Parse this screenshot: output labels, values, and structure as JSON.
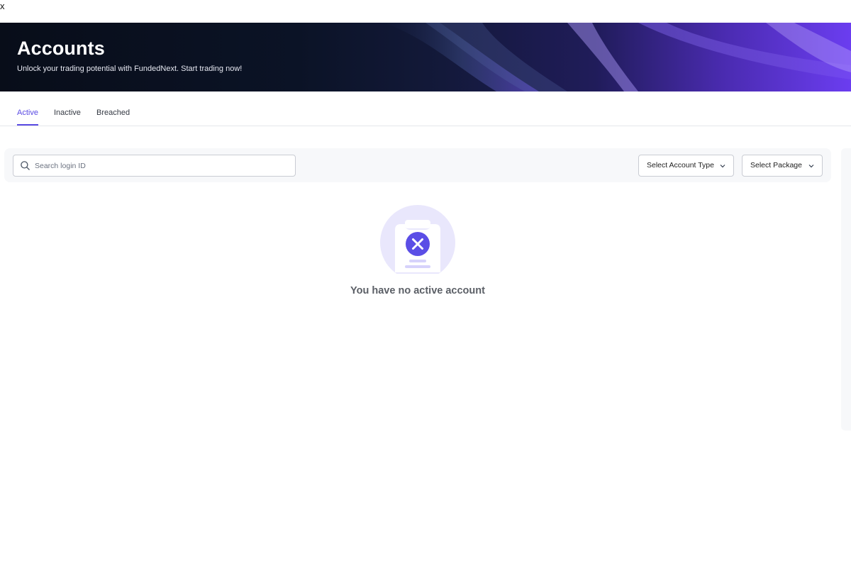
{
  "corner_glyph": "x",
  "header": {
    "title": "Accounts",
    "subtitle": "Unlock your trading potential with FundedNext. Start trading now!"
  },
  "tabs": [
    {
      "label": "Active",
      "active": true
    },
    {
      "label": "Inactive",
      "active": false
    },
    {
      "label": "Breached",
      "active": false
    }
  ],
  "filters": {
    "search": {
      "placeholder": "Search login ID",
      "value": "",
      "icon": "search-icon"
    },
    "account_type": {
      "label": "Select Account Type",
      "icon": "chevron-down-icon"
    },
    "package": {
      "label": "Select Package",
      "icon": "chevron-down-icon"
    }
  },
  "empty_state": {
    "icon": "empty-account-icon",
    "message": "You have no active account"
  },
  "colors": {
    "accent": "#5a4be3",
    "hero_dark": "#080d19",
    "hero_purple": "#6b3df0",
    "illustration_bg": "#e9e7fc"
  }
}
